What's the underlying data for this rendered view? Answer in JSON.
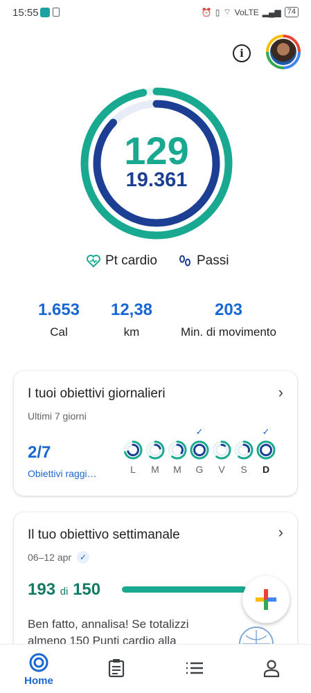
{
  "status_bar": {
    "time": "15:55",
    "network": "VoLTE",
    "battery": "74"
  },
  "summary": {
    "heart_points": "129",
    "steps": "19.361",
    "legend_heart": "Pt cardio",
    "legend_steps": "Passi",
    "heart_ring_fraction": 0.97,
    "steps_ring_fraction": 0.87
  },
  "stats": [
    {
      "value": "1.653",
      "label": "Cal"
    },
    {
      "value": "12,38",
      "label": "km"
    },
    {
      "value": "203",
      "label": "Min. di movimento"
    }
  ],
  "daily_goals": {
    "title": "I tuoi obiettivi giornalieri",
    "subtitle": "Ultimi 7 giorni",
    "count": "2/7",
    "count_label": "Obiettivi raggi…",
    "days": [
      {
        "label": "L",
        "achieved": false,
        "progress": 0.7
      },
      {
        "label": "M",
        "achieved": false,
        "progress": 0.2
      },
      {
        "label": "M",
        "achieved": false,
        "progress": 0.35
      },
      {
        "label": "G",
        "achieved": true,
        "progress": 1
      },
      {
        "label": "V",
        "achieved": false,
        "progress": 0.1
      },
      {
        "label": "S",
        "achieved": false,
        "progress": 0.3
      },
      {
        "label": "D",
        "achieved": true,
        "progress": 1,
        "today": true
      }
    ]
  },
  "weekly_goal": {
    "title": "Il tuo obiettivo settimanale",
    "date_range": "06–12 apr",
    "achieved": "193",
    "of_word": "di",
    "goal": "150",
    "progress": 1.0,
    "message": "Ben fatto, annalisa! Se totalizzi almeno 150 Punti cardio alla"
  },
  "bottom_nav": {
    "home_label": "Home",
    "items": [
      "home-icon",
      "journal-icon",
      "browse-icon",
      "profile-icon"
    ]
  },
  "colors": {
    "teal": "#19a991",
    "navy": "#1c3f94",
    "blue": "#1967d2"
  }
}
